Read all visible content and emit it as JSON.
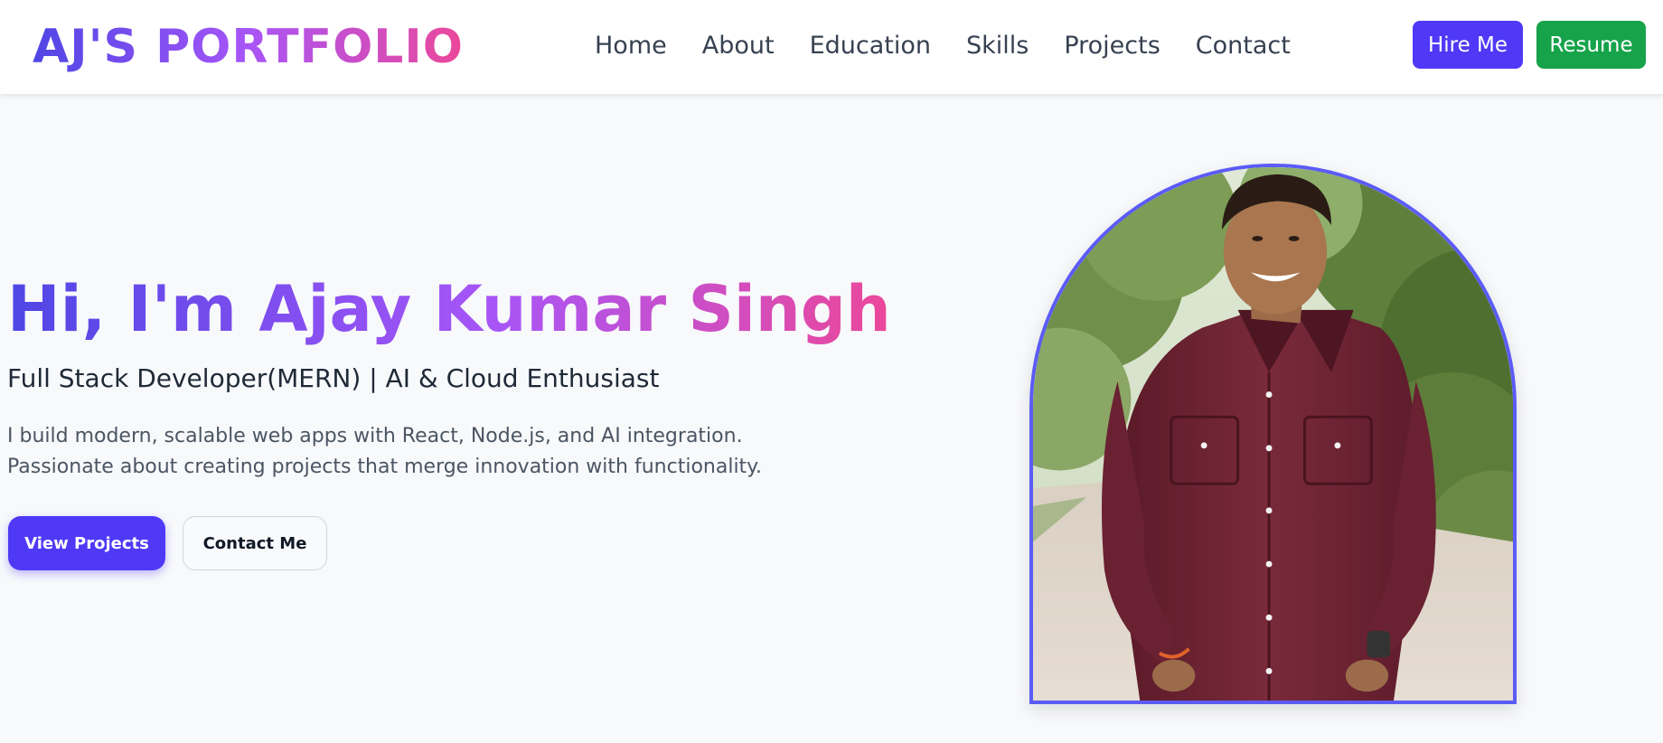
{
  "header": {
    "brand": "AJ'S PORTFOLIO",
    "nav": [
      "Home",
      "About",
      "Education",
      "Skills",
      "Projects",
      "Contact"
    ],
    "hire_label": "Hire Me",
    "resume_label": "Resume"
  },
  "hero": {
    "title": "Hi, I'm Ajay Kumar Singh",
    "subtitle": "Full Stack Developer(MERN) | AI & Cloud Enthusiast",
    "description_line1": "I build modern, scalable web apps with React, Node.js, and AI integration.",
    "description_line2": "Passionate about creating projects that merge innovation with functionality.",
    "view_projects_label": "View Projects",
    "contact_label": "Contact Me"
  },
  "colors": {
    "primary": "#4f39f6",
    "resume": "#16a34a",
    "gradient_start": "#4f46e5",
    "gradient_mid": "#a855f7",
    "gradient_end": "#ec4899",
    "portrait_border": "#5b5bf6"
  }
}
